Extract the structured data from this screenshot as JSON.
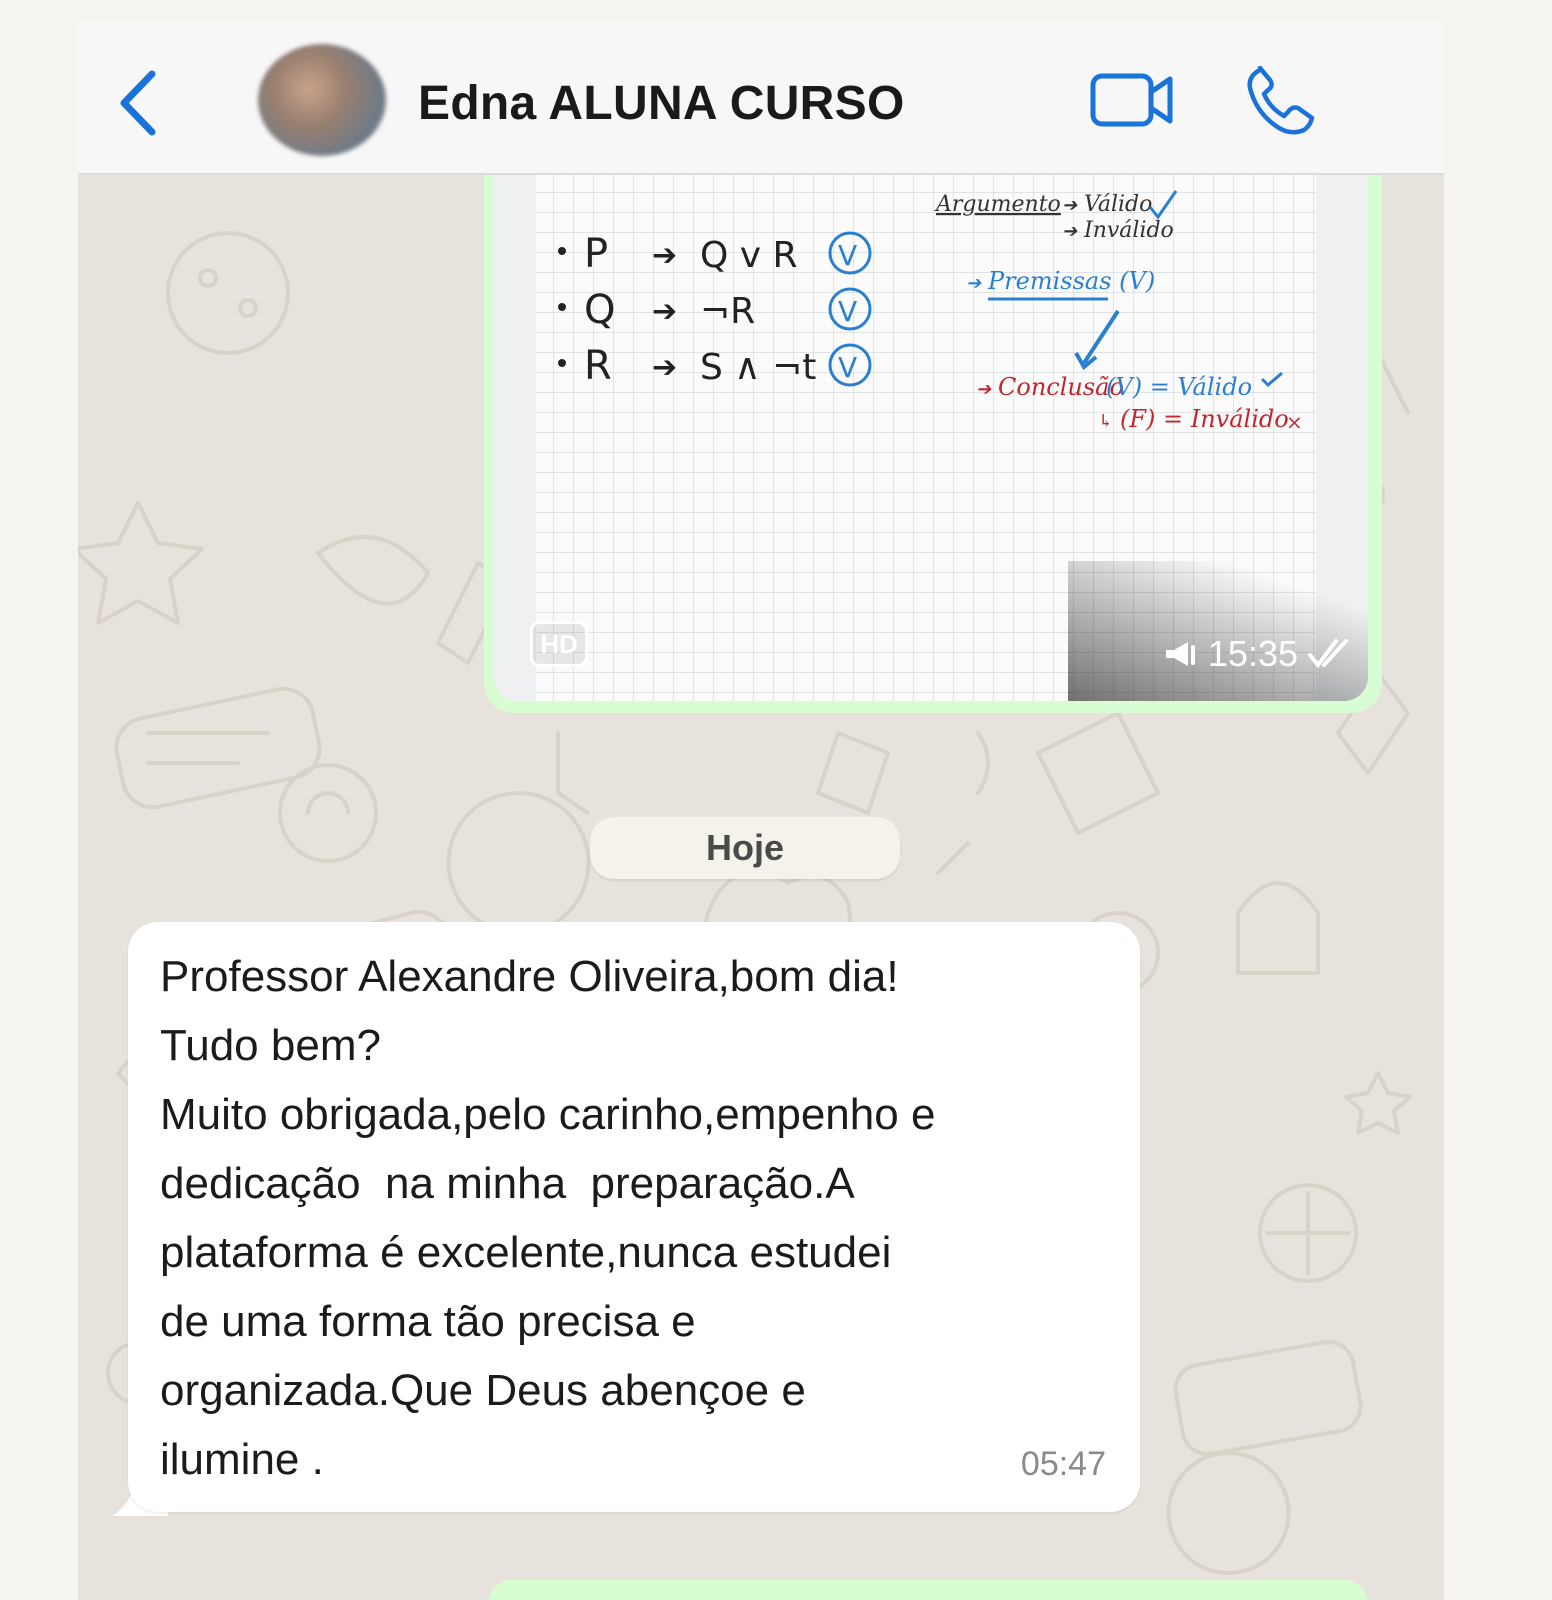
{
  "header": {
    "title": "Edna ALUNA CURSO",
    "back_icon": "chevron-left-icon",
    "video_icon": "video-camera-icon",
    "call_icon": "phone-icon",
    "accent_color": "#1a73d9"
  },
  "image_message": {
    "hd_badge": "HD",
    "time": "15:35",
    "status_icon": "double-check-icon",
    "notes": {
      "rows": [
        {
          "premise": "P",
          "conclusion": "Q v R",
          "mark": "V"
        },
        {
          "premise": "Q",
          "conclusion": "¬R",
          "mark": "V"
        },
        {
          "premise": "R",
          "conclusion": "S ∧ ¬t",
          "mark": "V"
        }
      ],
      "argumento": "Argumento",
      "valido": "Válido",
      "invalido": "Inválido",
      "premissas": "Premissas (V)",
      "conclusao": "Conclusão",
      "conclusao_v": "(V) = Válido",
      "conclusao_f": "(F) = Inválido"
    }
  },
  "date_chip": "Hoje",
  "text_message": {
    "text": "Professor Alexandre Oliveira,bom dia!\nTudo bem?\nMuito obrigada,pelo carinho,empenho e\ndedicação  na minha  preparação.A\nplataforma é excelente,nunca estudei\nde uma forma tão precisa e\norganizada.Que Deus abençoe e\nilumine .",
    "time": "05:47"
  },
  "colors": {
    "chat_background": "#e7e2db",
    "outgoing_bubble": "#d9fdd3",
    "incoming_bubble": "#ffffff",
    "header_background": "#f7f7f7"
  }
}
